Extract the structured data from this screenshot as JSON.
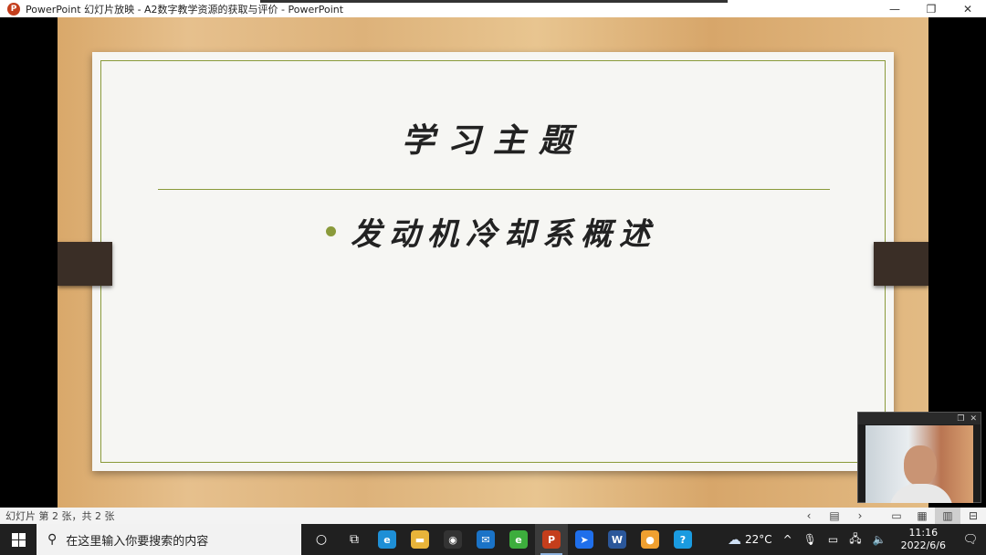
{
  "window": {
    "app_icon_letter": "P",
    "title": "PowerPoint 幻灯片放映  -  A2数字教学资源的获取与评价 - PowerPoint",
    "minimize": "—",
    "restore": "❐",
    "close": "✕"
  },
  "slide": {
    "title": "学习主题",
    "bullet": "发动机冷却系概述",
    "accent_color": "#8a9a3a"
  },
  "webcam": {
    "restore": "❐",
    "close": "✕"
  },
  "statusbar": {
    "slide_info": "幻灯片 第 2 张，共 2 张",
    "prev": "‹",
    "menu": "▤",
    "next": "›",
    "normal_view": "▭",
    "sorter_view": "▦",
    "reading_view": "▥",
    "slideshow_view": "⊟"
  },
  "taskbar": {
    "search_placeholder": "在这里输入你要搜索的内容",
    "search_icon": "⚲",
    "cortana": "○",
    "task_view": "⧉",
    "apps": [
      {
        "name": "edge",
        "glyph": "e",
        "color": "#1e8fd6"
      },
      {
        "name": "file-explorer",
        "glyph": "▬",
        "color": "#e8b43a"
      },
      {
        "name": "github",
        "glyph": "◉",
        "color": "#333333"
      },
      {
        "name": "mail",
        "glyph": "✉",
        "color": "#1a73c7"
      },
      {
        "name": "browser-360",
        "glyph": "e",
        "color": "#3dad3d"
      },
      {
        "name": "powerpoint",
        "glyph": "P",
        "color": "#c43e1c"
      },
      {
        "name": "feishu",
        "glyph": "➤",
        "color": "#1f6feb"
      },
      {
        "name": "word",
        "glyph": "W",
        "color": "#2b579a"
      },
      {
        "name": "recorder",
        "glyph": "●",
        "color": "#f0a030"
      },
      {
        "name": "help",
        "glyph": "?",
        "color": "#1a9be0"
      }
    ],
    "weather": "22°C",
    "weather_icon": "☁",
    "tray_up": "^",
    "mic_icon": "🎙",
    "battery_icon": "▭",
    "network_icon": "🖧",
    "volume_icon": "🔈",
    "time": "11:16",
    "date": "2022/6/6",
    "notification_icon": "🗨"
  }
}
